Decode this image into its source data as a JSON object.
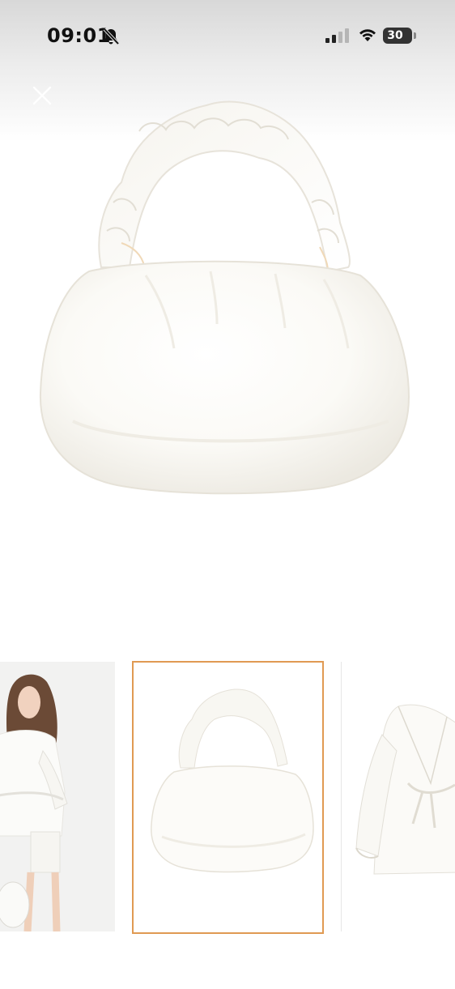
{
  "status_bar": {
    "time": "09:01",
    "battery_level": "30",
    "icons": [
      "bell-off-icon",
      "cellular-signal-icon",
      "wifi-icon",
      "battery-icon"
    ]
  },
  "header": {
    "close_icon": "close-icon"
  },
  "product_image": {
    "description_icon": "handbag-image"
  },
  "thumbnails": {
    "selected_index": 1,
    "accent_color": "#e09a52",
    "items": [
      {
        "name": "model-wearing-robe-thumbnail"
      },
      {
        "name": "satin-handbag-thumbnail"
      },
      {
        "name": "satin-robe-thumbnail"
      }
    ]
  }
}
